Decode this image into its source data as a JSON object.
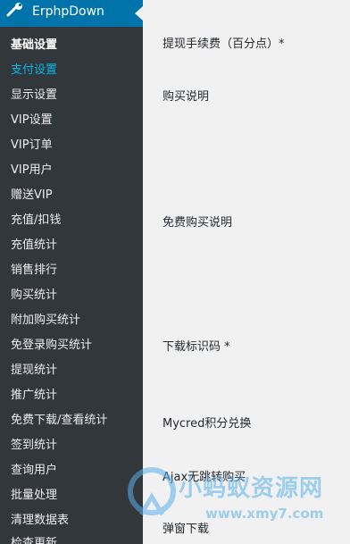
{
  "header": {
    "title": "ErphpDown",
    "icon": "wrench-icon"
  },
  "sidebar": {
    "items": [
      {
        "label": "基础设置",
        "state": "active"
      },
      {
        "label": "支付设置",
        "state": "hover"
      },
      {
        "label": "显示设置"
      },
      {
        "label": "VIP设置"
      },
      {
        "label": "VIP订单"
      },
      {
        "label": "VIP用户"
      },
      {
        "label": "赠送VIP"
      },
      {
        "label": "充值/扣钱"
      },
      {
        "label": "充值统计"
      },
      {
        "label": "销售排行"
      },
      {
        "label": "购买统计"
      },
      {
        "label": "附加购买统计"
      },
      {
        "label": "免登录购买统计"
      },
      {
        "label": "提现统计"
      },
      {
        "label": "推广统计"
      },
      {
        "label": "免费下载/查看统计"
      },
      {
        "label": "签到统计"
      },
      {
        "label": "查询用户"
      },
      {
        "label": "批量处理"
      },
      {
        "label": "清理数据表"
      },
      {
        "label": "检查更新"
      }
    ]
  },
  "settings": {
    "labels": [
      "提现手续费（百分点）*",
      "购买说明",
      "免费购买说明",
      "下载标识码 *",
      "Mycred积分兑换",
      "Ajax无跳转购买",
      "弹窗下载"
    ]
  },
  "watermark": {
    "text": "小蚂蚁资源网",
    "url": "www.xmy7.com"
  },
  "colors": {
    "sidebar_bg": "#32373c",
    "header_bg": "#0073aa",
    "current_item": "#00b9eb",
    "content_bg": "#f1f1f1"
  }
}
